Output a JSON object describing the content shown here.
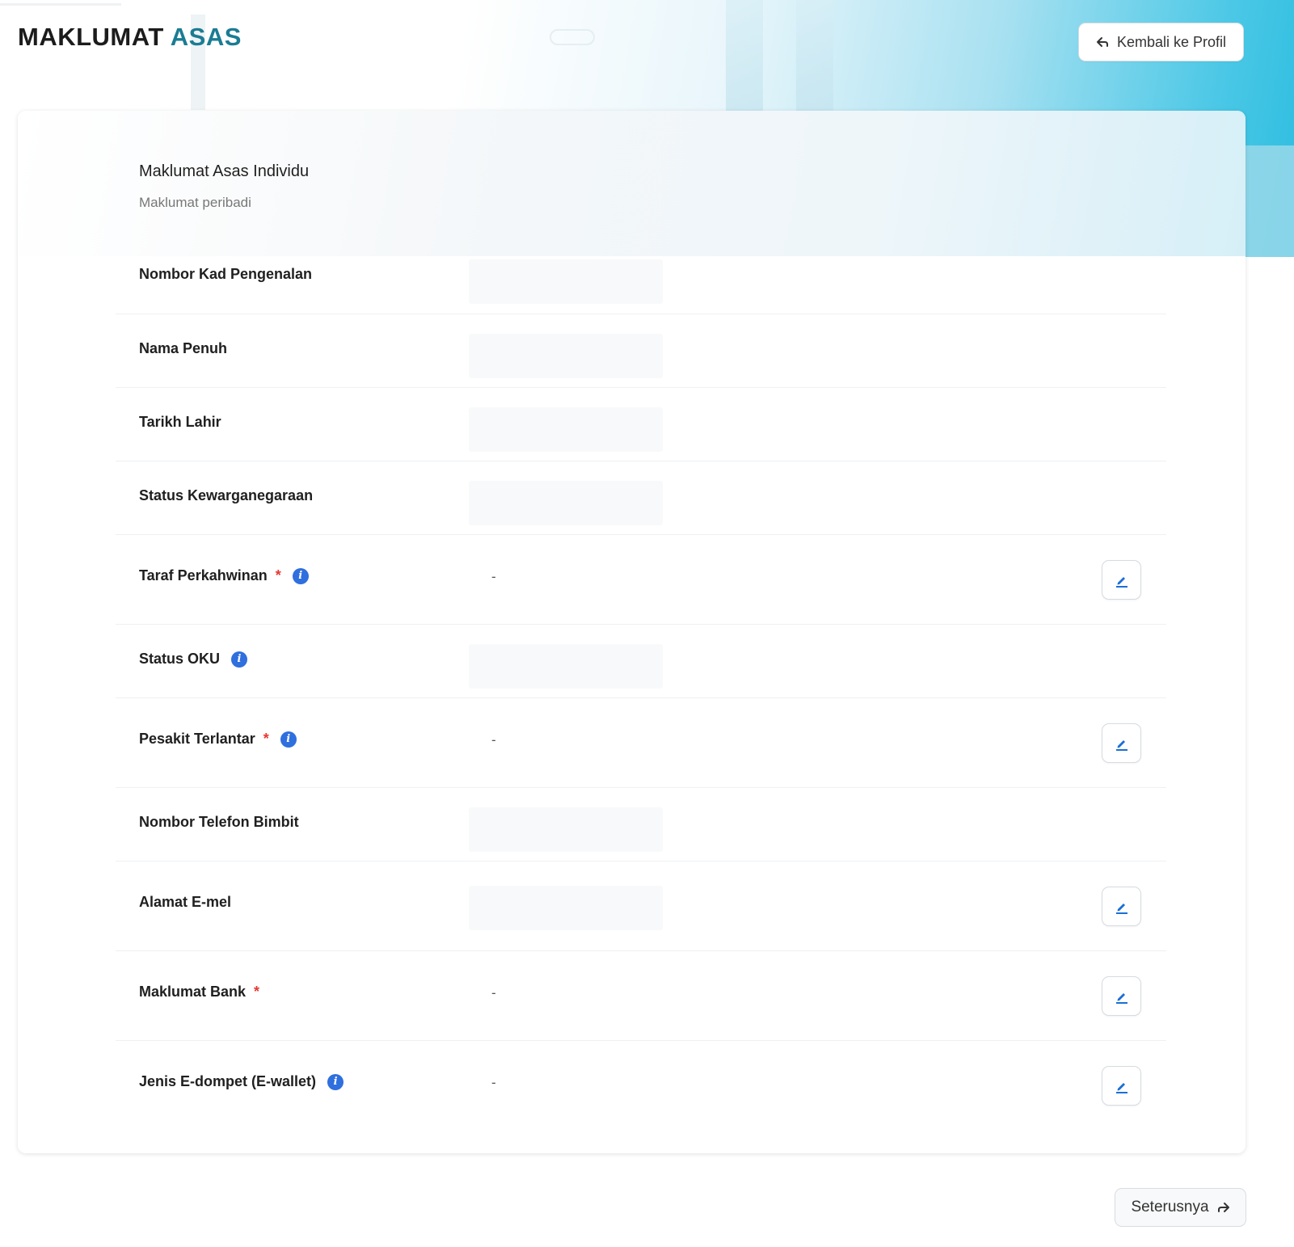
{
  "header": {
    "title_main": "MAKLUMAT",
    "title_accent": "ASAS",
    "back_label": "Kembali ke Profil"
  },
  "card": {
    "title": "Maklumat Asas Individu",
    "subtitle": "Maklumat peribadi"
  },
  "fields": [
    {
      "label": "Nombor Kad Pengenalan",
      "value": "",
      "required": false,
      "info": false,
      "editable": false
    },
    {
      "label": "Nama Penuh",
      "value": "",
      "required": false,
      "info": false,
      "editable": false
    },
    {
      "label": "Tarikh Lahir",
      "value": "",
      "required": false,
      "info": false,
      "editable": false
    },
    {
      "label": "Status Kewarganegaraan",
      "value": "",
      "required": false,
      "info": false,
      "editable": false
    },
    {
      "label": "Taraf Perkahwinan",
      "value": "-",
      "required": true,
      "info": true,
      "editable": true
    },
    {
      "label": "Status OKU",
      "value": "",
      "required": false,
      "info": true,
      "editable": false
    },
    {
      "label": "Pesakit Terlantar",
      "value": "-",
      "required": true,
      "info": true,
      "editable": true
    },
    {
      "label": "Nombor Telefon Bimbit",
      "value": "",
      "required": false,
      "info": false,
      "editable": false
    },
    {
      "label": "Alamat E-mel",
      "value": "",
      "required": false,
      "info": false,
      "editable": true
    },
    {
      "label": "Maklumat Bank",
      "value": "-",
      "required": true,
      "info": false,
      "editable": true
    },
    {
      "label": "Jenis E-dompet (E-wallet)",
      "value": "-",
      "required": false,
      "info": true,
      "editable": true
    }
  ],
  "symbols": {
    "required": "*",
    "info": "i"
  },
  "footer": {
    "next_label": "Seterusnya"
  },
  "colors": {
    "accent": "#1b7c93",
    "info": "#2f6fde",
    "required": "#e53935",
    "edit_icon": "#1a6fd6"
  }
}
